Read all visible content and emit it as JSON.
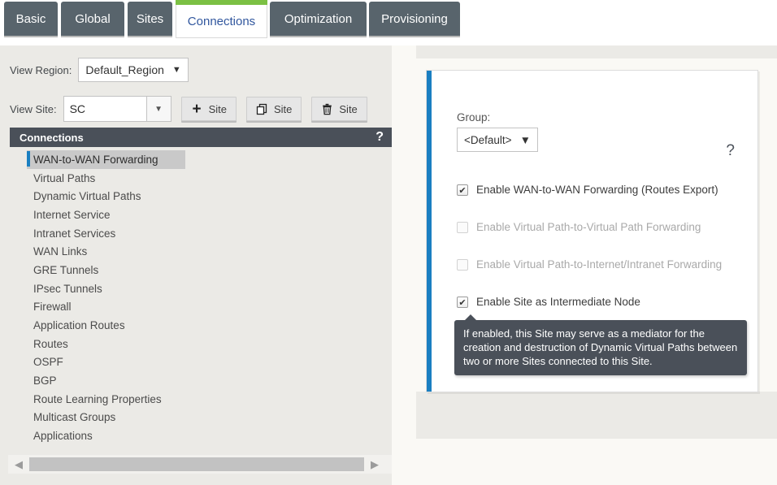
{
  "tabs": [
    {
      "label": "Basic",
      "active": false
    },
    {
      "label": "Global",
      "active": false
    },
    {
      "label": "Sites",
      "active": false
    },
    {
      "label": "Connections",
      "active": true
    },
    {
      "label": "Optimization",
      "active": false
    },
    {
      "label": "Provisioning",
      "active": false
    }
  ],
  "left": {
    "view_region_label": "View Region:",
    "view_region_value": "Default_Region",
    "view_site_label": "View Site:",
    "view_site_value": "SC",
    "buttons": [
      {
        "icon": "plus-icon",
        "label": "Site"
      },
      {
        "icon": "copy-icon",
        "label": "Site"
      },
      {
        "icon": "trash-icon",
        "label": "Site"
      }
    ],
    "panel": {
      "title": "Connections",
      "help": "?",
      "items": [
        "WAN-to-WAN Forwarding",
        "Virtual Paths",
        "Dynamic Virtual Paths",
        "Internet Service",
        "Intranet Services",
        "WAN Links",
        "GRE Tunnels",
        "IPsec Tunnels",
        "Firewall",
        "Application Routes",
        "Routes",
        "OSPF",
        "BGP",
        "Route Learning Properties",
        "Multicast Groups",
        "Applications"
      ],
      "selected_index": 0
    },
    "scrollbar": {
      "left_arrow": "◀",
      "right_arrow": "▶"
    }
  },
  "right": {
    "help": "?",
    "group_label": "Group:",
    "group_value": "<Default>",
    "caret": "▼",
    "checkboxes": [
      {
        "label": "Enable WAN-to-WAN Forwarding (Routes Export)",
        "checked": true,
        "disabled": false
      },
      {
        "label": "Enable Virtual Path-to-Virtual Path Forwarding",
        "checked": false,
        "disabled": true
      },
      {
        "label": "Enable Virtual Path-to-Internet/Intranet Forwarding",
        "checked": false,
        "disabled": true
      },
      {
        "label": "Enable Site as Intermediate Node",
        "checked": true,
        "disabled": false
      }
    ],
    "checkmark": "✔",
    "tooltip": "If enabled, this Site may serve as a mediator for the creation and destruction of Dynamic Virtual Paths between two or more Sites connected to this Site."
  },
  "colors": {
    "tab_inactive_bg": "#58646c",
    "tab_active_text": "#31579e",
    "tab_active_accent": "#7bc043",
    "panel_header_bg": "#4a5059",
    "card_accent": "#1a7fc1",
    "selection_bg": "#c9c9c9",
    "page_bg": "#ebeae6"
  }
}
